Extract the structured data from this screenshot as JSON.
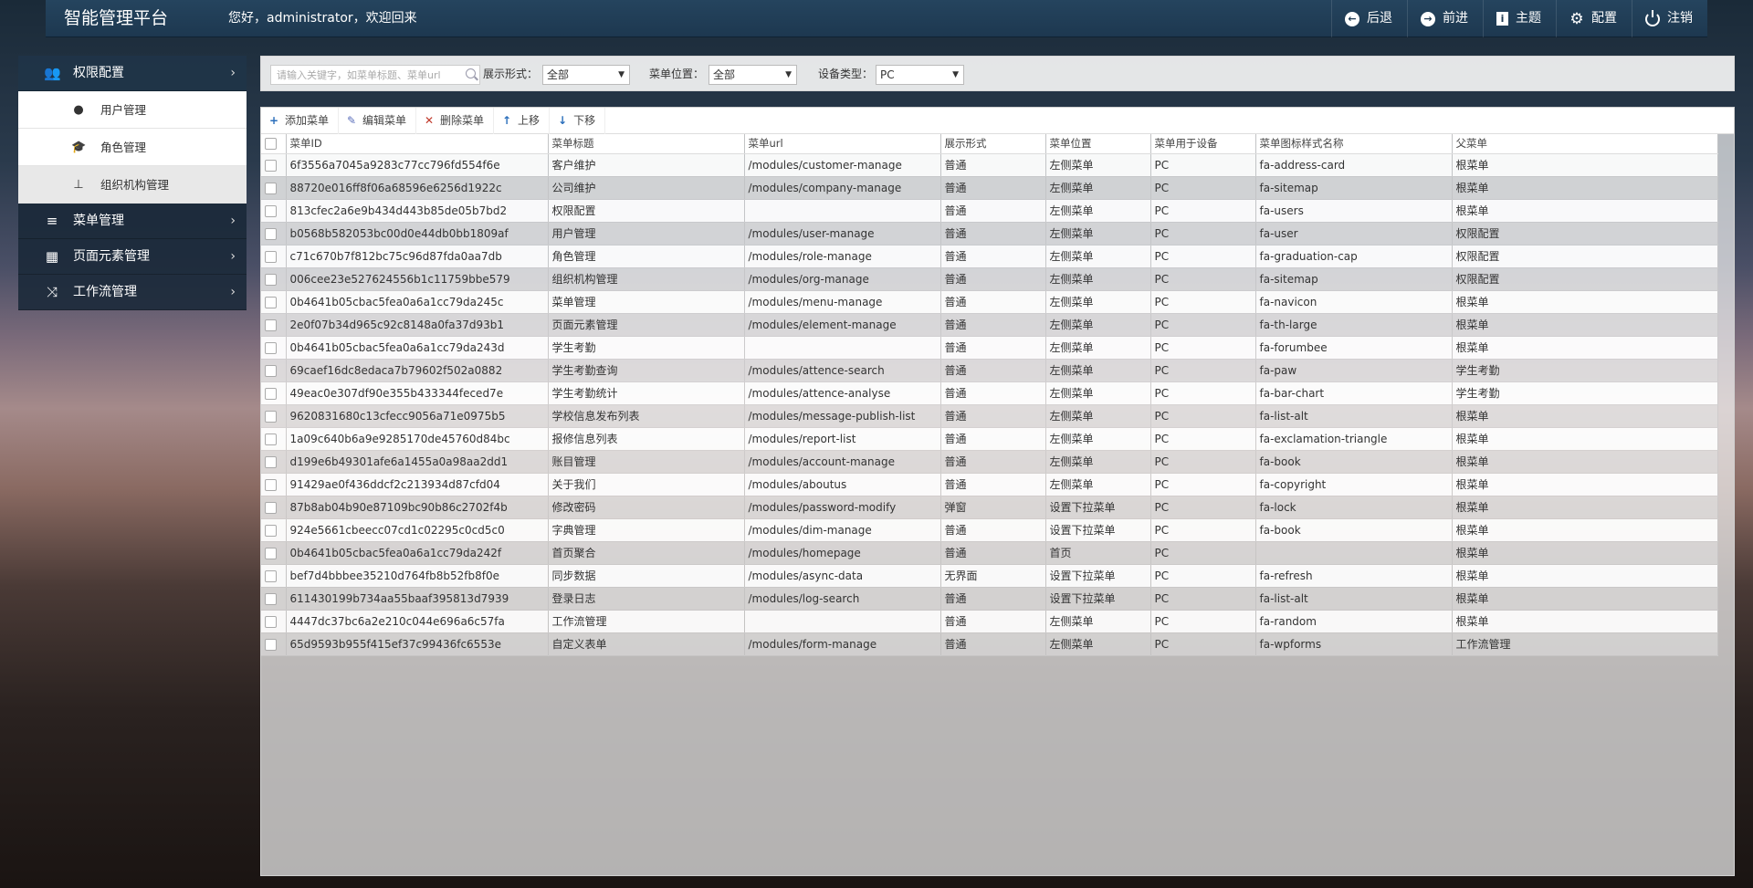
{
  "header": {
    "title": "智能管理平台",
    "welcome": "您好，administrator，欢迎回来",
    "nav": [
      {
        "label": "后退",
        "icon": "arrow-left-circle-icon"
      },
      {
        "label": "前进",
        "icon": "arrow-right-circle-icon"
      },
      {
        "label": "主题",
        "icon": "theme-icon"
      },
      {
        "label": "配置",
        "icon": "gear-icon"
      },
      {
        "label": "注销",
        "icon": "power-icon"
      }
    ]
  },
  "sidebar": {
    "groups": [
      {
        "label": "权限配置",
        "icon": "users-icon",
        "children": [
          {
            "label": "用户管理",
            "icon": "user-icon"
          },
          {
            "label": "角色管理",
            "icon": "graduation-cap-icon"
          },
          {
            "label": "组织机构管理",
            "icon": "sitemap-icon"
          }
        ]
      },
      {
        "label": "菜单管理",
        "icon": "navicon-icon"
      },
      {
        "label": "页面元素管理",
        "icon": "th-large-icon"
      },
      {
        "label": "工作流管理",
        "icon": "random-icon"
      }
    ]
  },
  "filters": {
    "search_placeholder": "请输入关键字，如菜单标题、菜单url",
    "display_label": "展示形式：",
    "display_value": "全部",
    "position_label": "菜单位置：",
    "position_value": "全部",
    "device_label": "设备类型：",
    "device_value": "PC"
  },
  "toolbar": {
    "add": "添加菜单",
    "edit": "编辑菜单",
    "delete": "删除菜单",
    "up": "上移",
    "down": "下移"
  },
  "table": {
    "columns": [
      "菜单ID",
      "菜单标题",
      "菜单url",
      "展示形式",
      "菜单位置",
      "菜单用于设备",
      "菜单图标样式名称",
      "父菜单"
    ],
    "rows": [
      [
        "6f3556a7045a9283c77cc796fd554f6e",
        "客户维护",
        "/modules/customer-manage",
        "普通",
        "左侧菜单",
        "PC",
        "fa-address-card",
        "根菜单"
      ],
      [
        "88720e016ff8f06a68596e6256d1922c",
        "公司维护",
        "/modules/company-manage",
        "普通",
        "左侧菜单",
        "PC",
        "fa-sitemap",
        "根菜单"
      ],
      [
        "813cfec2a6e9b434d443b85de05b7bd2",
        "权限配置",
        "",
        "普通",
        "左侧菜单",
        "PC",
        "fa-users",
        "根菜单"
      ],
      [
        "b0568b582053bc00d0e44db0bb1809af",
        "用户管理",
        "/modules/user-manage",
        "普通",
        "左侧菜单",
        "PC",
        "fa-user",
        "权限配置"
      ],
      [
        "c71c670b7f812bc75c96d87fda0aa7db",
        "角色管理",
        "/modules/role-manage",
        "普通",
        "左侧菜单",
        "PC",
        "fa-graduation-cap",
        "权限配置"
      ],
      [
        "006cee23e527624556b1c11759bbe579",
        "组织机构管理",
        "/modules/org-manage",
        "普通",
        "左侧菜单",
        "PC",
        "fa-sitemap",
        "权限配置"
      ],
      [
        "0b4641b05cbac5fea0a6a1cc79da245c",
        "菜单管理",
        "/modules/menu-manage",
        "普通",
        "左侧菜单",
        "PC",
        "fa-navicon",
        "根菜单"
      ],
      [
        "2e0f07b34d965c92c8148a0fa37d93b1",
        "页面元素管理",
        "/modules/element-manage",
        "普通",
        "左侧菜单",
        "PC",
        "fa-th-large",
        "根菜单"
      ],
      [
        "0b4641b05cbac5fea0a6a1cc79da243d",
        "学生考勤",
        "",
        "普通",
        "左侧菜单",
        "PC",
        "fa-forumbee",
        "根菜单"
      ],
      [
        "69caef16dc8edaca7b79602f502a0882",
        "学生考勤查询",
        "/modules/attence-search",
        "普通",
        "左侧菜单",
        "PC",
        "fa-paw",
        "学生考勤"
      ],
      [
        "49eac0e307df90e355b433344feced7e",
        "学生考勤统计",
        "/modules/attence-analyse",
        "普通",
        "左侧菜单",
        "PC",
        "fa-bar-chart",
        "学生考勤"
      ],
      [
        "9620831680c13cfecc9056a71e0975b5",
        "学校信息发布列表",
        "/modules/message-publish-list",
        "普通",
        "左侧菜单",
        "PC",
        "fa-list-alt",
        "根菜单"
      ],
      [
        "1a09c640b6a9e9285170de45760d84bc",
        "报修信息列表",
        "/modules/report-list",
        "普通",
        "左侧菜单",
        "PC",
        "fa-exclamation-triangle",
        "根菜单"
      ],
      [
        "d199e6b49301afe6a1455a0a98aa2dd1",
        "账目管理",
        "/modules/account-manage",
        "普通",
        "左侧菜单",
        "PC",
        "fa-book",
        "根菜单"
      ],
      [
        "91429ae0f436ddcf2c213934d87cfd04",
        "关于我们",
        "/modules/aboutus",
        "普通",
        "左侧菜单",
        "PC",
        "fa-copyright",
        "根菜单"
      ],
      [
        "87b8ab04b90e87109bc90b86c2702f4b",
        "修改密码",
        "/modules/password-modify",
        "弹窗",
        "设置下拉菜单",
        "PC",
        "fa-lock",
        "根菜单"
      ],
      [
        "924e5661cbeecc07cd1c02295c0cd5c0",
        "字典管理",
        "/modules/dim-manage",
        "普通",
        "设置下拉菜单",
        "PC",
        "fa-book",
        "根菜单"
      ],
      [
        "0b4641b05cbac5fea0a6a1cc79da242f",
        "首页聚合",
        "/modules/homepage",
        "普通",
        "首页",
        "PC",
        "",
        "根菜单"
      ],
      [
        "bef7d4bbbee35210d764fb8b52fb8f0e",
        "同步数据",
        "/modules/async-data",
        "无界面",
        "设置下拉菜单",
        "PC",
        "fa-refresh",
        "根菜单"
      ],
      [
        "611430199b734aa55baaf395813d7939",
        "登录日志",
        "/modules/log-search",
        "普通",
        "设置下拉菜单",
        "PC",
        "fa-list-alt",
        "根菜单"
      ],
      [
        "4447dc37bc6a2e210c044e696a6c57fa",
        "工作流管理",
        "",
        "普通",
        "左侧菜单",
        "PC",
        "fa-random",
        "根菜单"
      ],
      [
        "65d9593b955f415ef37c99436fc6553e",
        "自定义表单",
        "/modules/form-manage",
        "普通",
        "左侧菜单",
        "PC",
        "fa-wpforms",
        "工作流管理"
      ]
    ]
  }
}
